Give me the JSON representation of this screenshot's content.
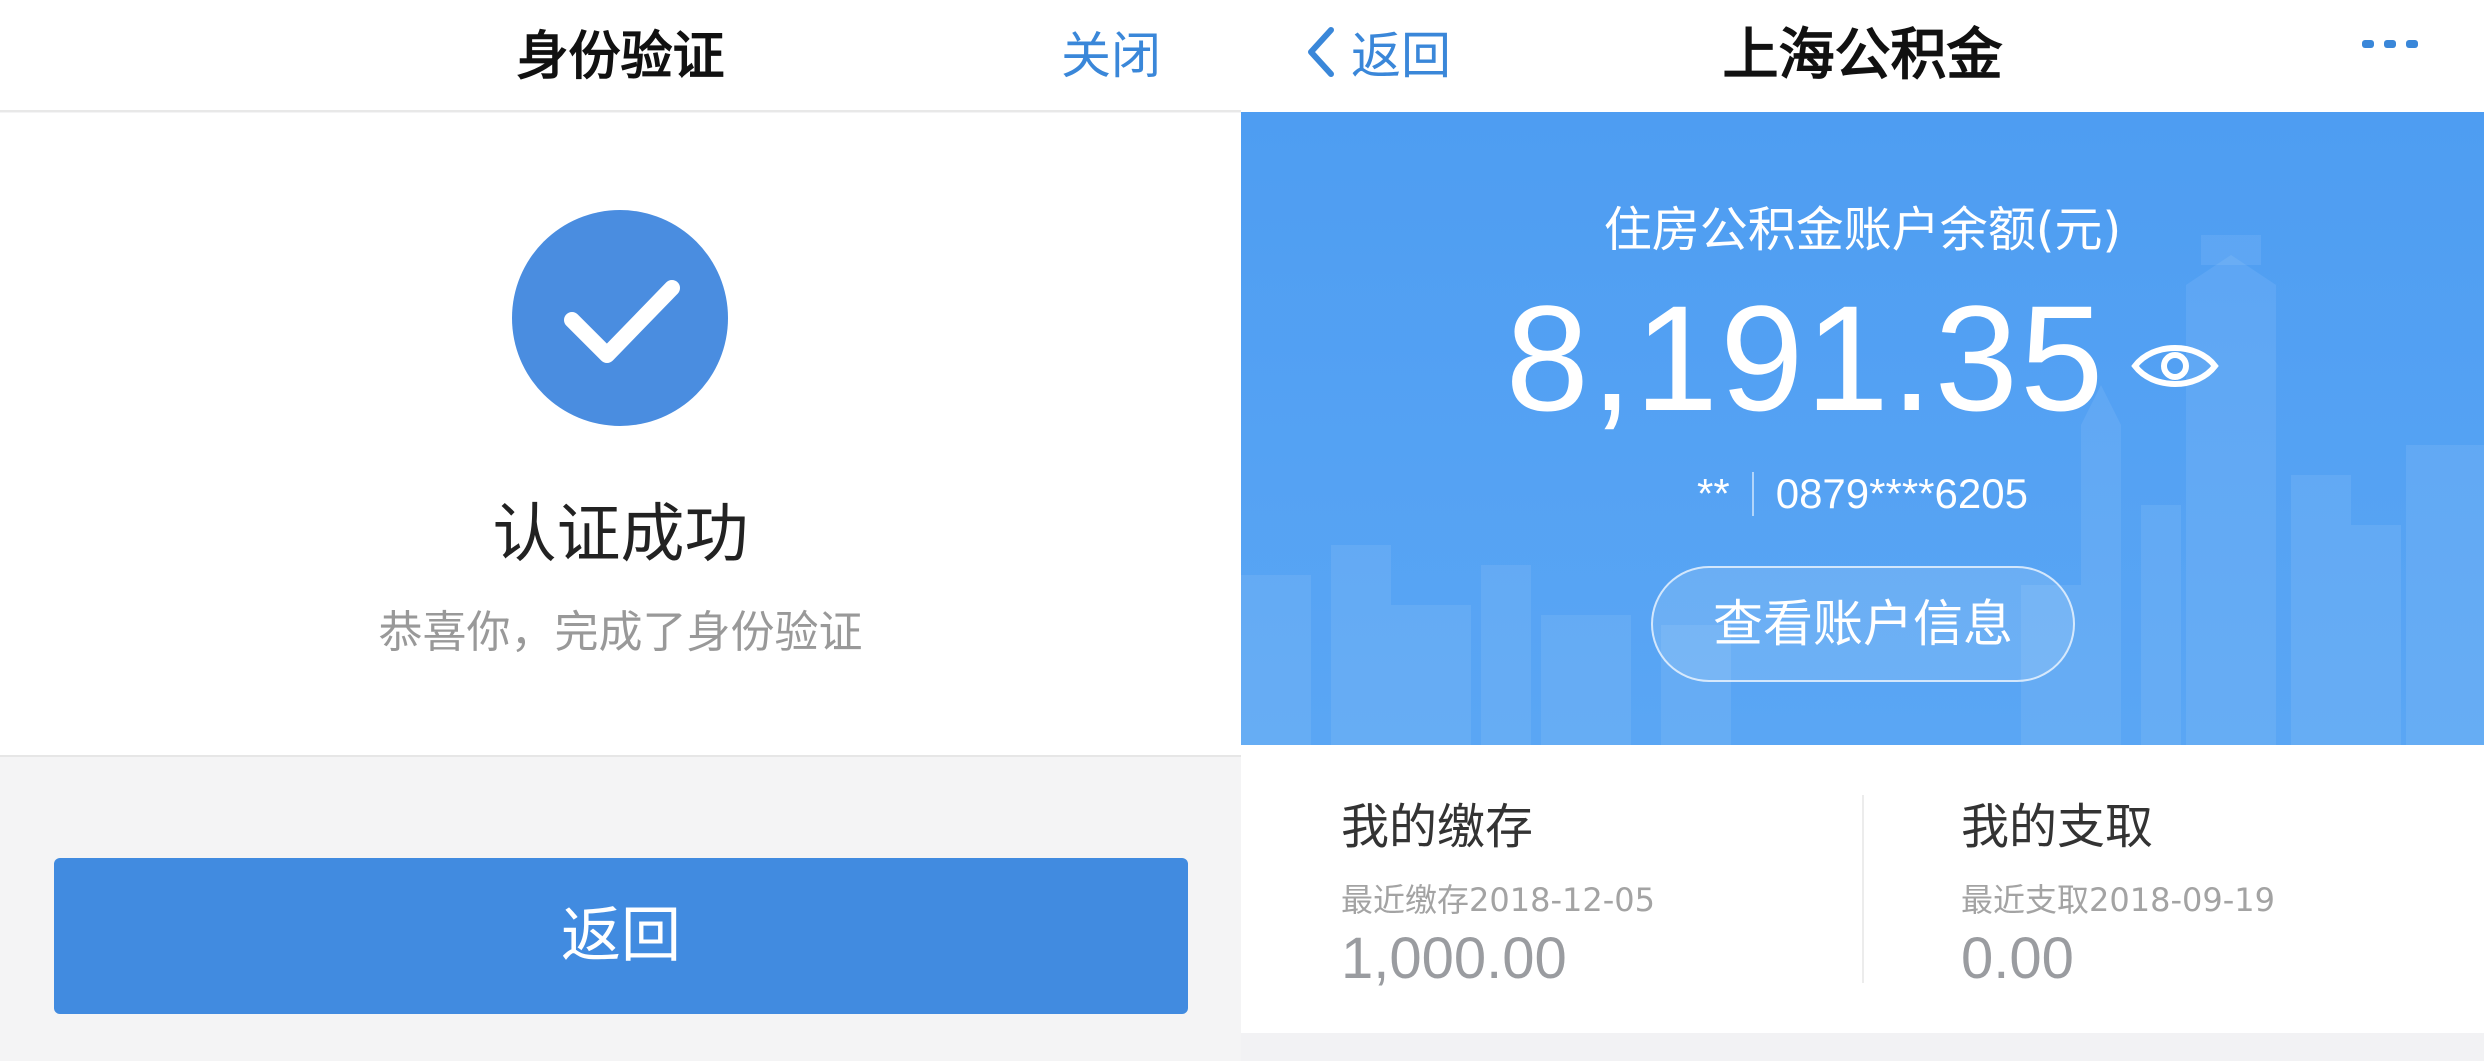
{
  "left": {
    "header": {
      "title": "身份验证",
      "close_label": "关闭"
    },
    "result": {
      "title": "认证成功",
      "subtitle": "恭喜你，完成了身份验证"
    },
    "return_label": "返回"
  },
  "right": {
    "header": {
      "back_label": "返回",
      "title": "上海公积金"
    },
    "hero": {
      "label": "住房公积金账户余额(元)",
      "balance": "8,191.35",
      "masked_name": "**",
      "account_number": "0879****6205",
      "info_button_label": "查看账户信息"
    },
    "stats": {
      "deposit": {
        "title": "我的缴存",
        "subtitle": "最近缴存2018-12-05",
        "value": "1,000.00"
      },
      "withdraw": {
        "title": "我的支取",
        "subtitle": "最近支取2018-09-19",
        "value": "0.00"
      }
    }
  },
  "colors": {
    "accent": "#418be0",
    "hero_blue": "#4e9df2",
    "link_blue": "#3a87d9"
  },
  "icons": {
    "success": "check-circle-icon",
    "back": "chevron-left-icon",
    "more": "more-dots-icon",
    "visibility": "eye-icon"
  }
}
